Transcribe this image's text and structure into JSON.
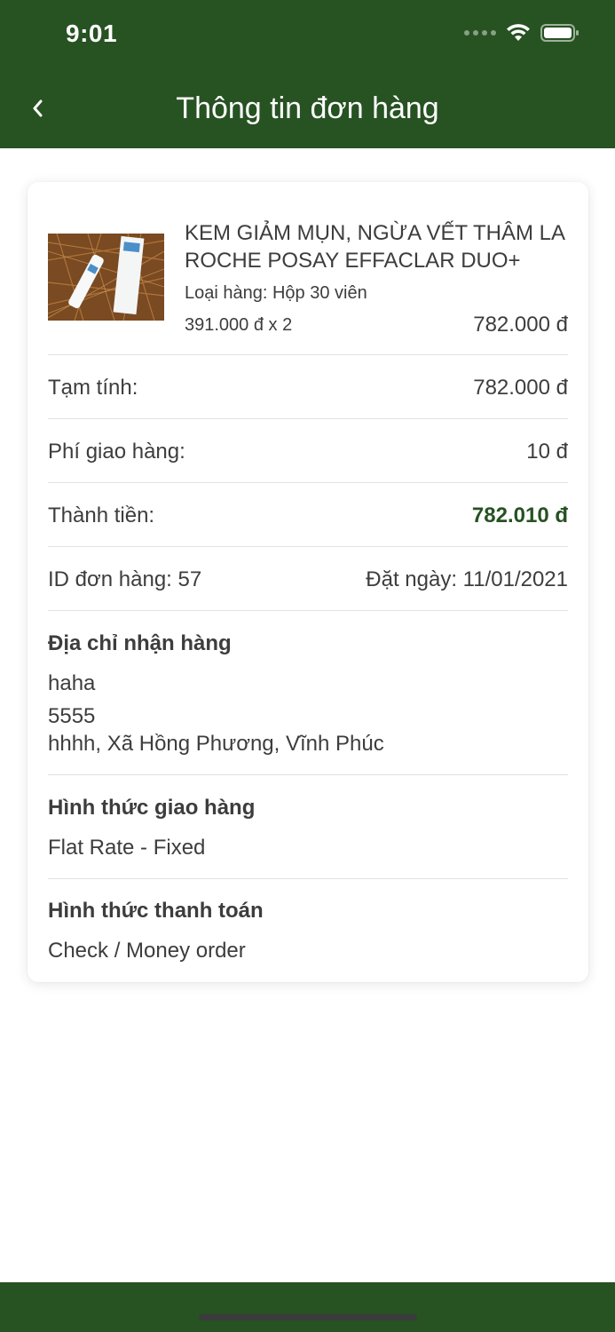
{
  "status_bar": {
    "time": "9:01"
  },
  "header": {
    "title": "Thông tin đơn hàng"
  },
  "product": {
    "name": "KEM GIẢM MỤN, NGỪA VẾT THÂM LA ROCHE POSAY EFFACLAR DUO+",
    "variant": "Loại hàng: Hộp 30 viên",
    "price_qty": "391.000 đ x 2",
    "line_total": "782.000 đ",
    "image_alt": "La Roche Posay Effaclar Duo+ product photo"
  },
  "summary": {
    "subtotal_label": "Tạm tính:",
    "subtotal_value": "782.000 đ",
    "shipping_label": "Phí giao hàng:",
    "shipping_value": "10 đ",
    "total_label": "Thành tiền:",
    "total_value": "782.010 đ",
    "order_id": "ID đơn hàng: 57",
    "order_date": "Đặt ngày: 11/01/2021"
  },
  "address": {
    "title": "Địa chỉ nhận hàng",
    "name": "haha",
    "phone": "5555",
    "location": "hhhh, Xã Hồng Phương, Vĩnh Phúc"
  },
  "shipping_method": {
    "title": "Hình thức giao hàng",
    "value": "Flat Rate - Fixed"
  },
  "payment_method": {
    "title": "Hình thức thanh toán",
    "value": "Check / Money order"
  },
  "colors": {
    "brand_green": "#275222",
    "text": "#3d3d3d",
    "divider": "#e2e2e2"
  },
  "icons": {
    "back": "chevron-left-icon",
    "wifi": "wifi-icon",
    "battery": "battery-icon",
    "signal": "signal-icon"
  }
}
